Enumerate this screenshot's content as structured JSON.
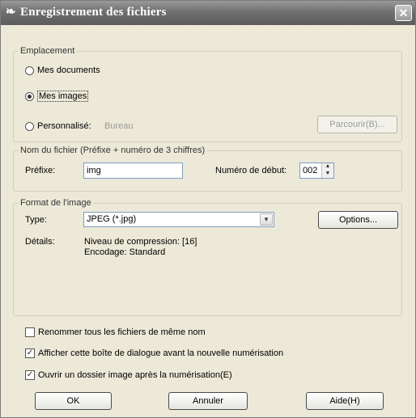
{
  "window": {
    "title": "Enregistrement des fichiers",
    "close_label": "✕"
  },
  "location": {
    "legend": "Emplacement",
    "option1": "Mes documents",
    "option2": "Mes images",
    "option3": "Personnalisé:",
    "custom_path": "Bureau",
    "browse_label": "Parcourir(B)...",
    "selected": "Mes images"
  },
  "filename": {
    "legend": "Nom du fichier (Préfixe + numéro de 3 chiffres)",
    "prefix_label": "Préfixe:",
    "prefix_value": "img",
    "start_label": "Numéro de début:",
    "start_value": "002"
  },
  "format": {
    "legend": "Format de l'image",
    "type_label": "Type:",
    "type_value": "JPEG (*.jpg)",
    "options_label": "Options...",
    "details_label": "Détails:",
    "details_line1": "Niveau de compression: [16]",
    "details_line2": "Encodage: Standard"
  },
  "checkboxes": {
    "rename": {
      "label": "Renommer tous les fichiers de même nom",
      "checked": false
    },
    "show_dialog": {
      "label": "Afficher cette boîte de dialogue avant la nouvelle numérisation",
      "checked": true
    },
    "open_folder": {
      "label": "Ouvrir un dossier image après la numérisation(E)",
      "checked": true
    }
  },
  "buttons": {
    "ok": "OK",
    "cancel": "Annuler",
    "help": "Aide(H)"
  }
}
